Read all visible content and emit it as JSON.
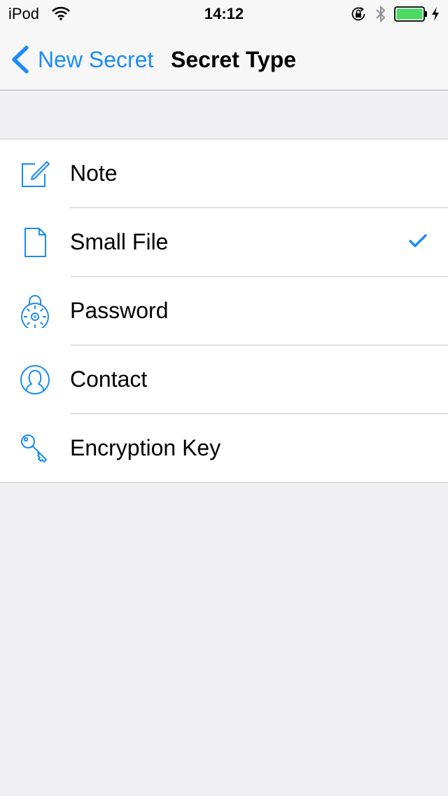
{
  "status_bar": {
    "carrier": "iPod",
    "time": "14:12",
    "battery_color": "#4cd964"
  },
  "nav": {
    "back_label": "New Secret",
    "title": "Secret Type"
  },
  "accent_color": "#1a8cf5",
  "secret_types": [
    {
      "label": "Note",
      "icon": "note-edit-icon",
      "selected": false
    },
    {
      "label": "Small File",
      "icon": "file-icon",
      "selected": true
    },
    {
      "label": "Password",
      "icon": "padlock-icon",
      "selected": false
    },
    {
      "label": "Contact",
      "icon": "contact-icon",
      "selected": false
    },
    {
      "label": "Encryption Key",
      "icon": "key-icon",
      "selected": false
    }
  ]
}
